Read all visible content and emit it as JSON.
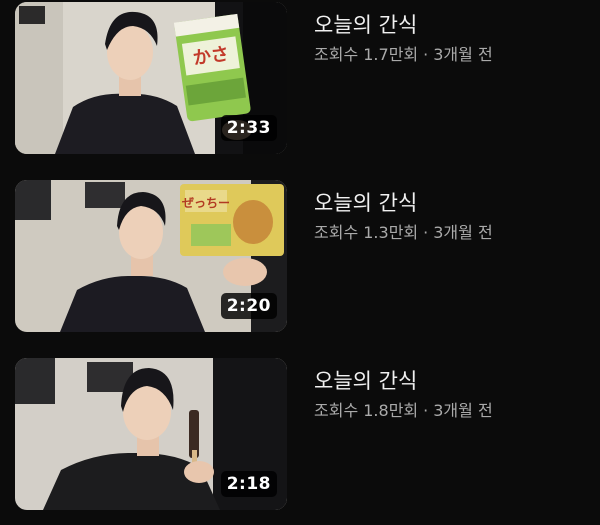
{
  "videos": [
    {
      "title": "오늘의 간식",
      "views": "조회수 1.7만회",
      "separator": "·",
      "age": "3개월 전",
      "duration": "2:33",
      "thumbnail": {
        "background": "#d9d5cc",
        "snack_color": "#8fc84e",
        "shirt_color": "#1d1c22"
      }
    },
    {
      "title": "오늘의 간식",
      "views": "조회수 1.3만회",
      "separator": "·",
      "age": "3개월 전",
      "duration": "2:20",
      "thumbnail": {
        "background": "#cfcac0",
        "snack_color": "#dfc95a",
        "shirt_color": "#1c1b22"
      }
    },
    {
      "title": "오늘의 간식",
      "views": "조회수 1.8만회",
      "separator": "·",
      "age": "3개월 전",
      "duration": "2:18",
      "thumbnail": {
        "background": "#d3cfc8",
        "snack_color": "#3b2a22",
        "shirt_color": "#1c1c1e"
      }
    }
  ]
}
